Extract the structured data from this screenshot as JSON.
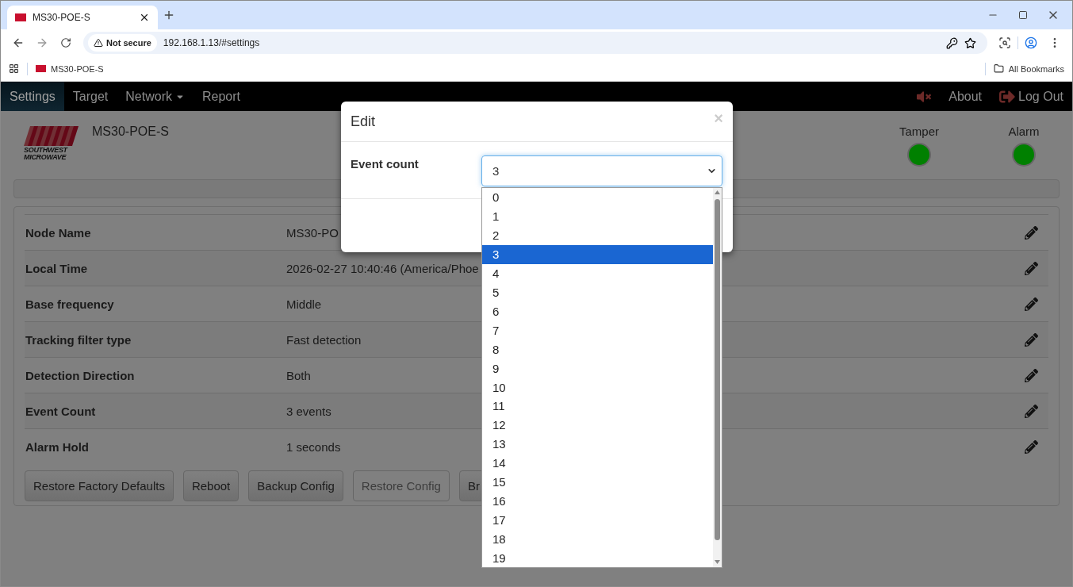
{
  "browser": {
    "tab_title": "MS30-POE-S",
    "security": "Not secure",
    "url": "192.168.1.13/#settings",
    "bookmarks": [
      {
        "label": "MS30-POE-S"
      }
    ],
    "all_bookmarks": "All Bookmarks"
  },
  "nav": {
    "items": [
      {
        "label": "Settings",
        "selected": true,
        "kind": "link"
      },
      {
        "label": "Target",
        "selected": false,
        "kind": "link"
      },
      {
        "label": "Network",
        "selected": false,
        "kind": "dropdown"
      },
      {
        "label": "Report",
        "selected": false,
        "kind": "link"
      }
    ],
    "about": "About",
    "logout": "Log Out"
  },
  "header": {
    "logo_lines": [
      "SOUTHWEST",
      "MICROWAVE"
    ],
    "device_name": "MS30-POE-S",
    "indicators": [
      {
        "label": "Tamper",
        "color": "#008000"
      },
      {
        "label": "Alarm",
        "color": "#008000"
      }
    ]
  },
  "settings": [
    {
      "label": "Node Name",
      "value": "MS30-PO"
    },
    {
      "label": "Local Time",
      "value": "2026-02-27 10:40:46 (America/Phoe"
    },
    {
      "label": "Base frequency",
      "value": "Middle"
    },
    {
      "label": "Tracking filter type",
      "value": "Fast detection"
    },
    {
      "label": "Detection Direction",
      "value": "Both"
    },
    {
      "label": "Event Count",
      "value": "3 events"
    },
    {
      "label": "Alarm Hold",
      "value": "1 seconds"
    }
  ],
  "buttons": [
    {
      "label": "Restore Factory Defaults",
      "disabled": false
    },
    {
      "label": "Reboot",
      "disabled": false
    },
    {
      "label": "Backup Config",
      "disabled": false
    },
    {
      "label": "Restore Config",
      "disabled": true
    },
    {
      "label": "Br",
      "disabled": false
    }
  ],
  "modal": {
    "title": "Edit",
    "close": "×",
    "field_label": "Event count",
    "value": "3",
    "options": [
      {
        "label": "0",
        "selected": false
      },
      {
        "label": "1",
        "selected": false
      },
      {
        "label": "2",
        "selected": false
      },
      {
        "label": "3",
        "selected": true
      },
      {
        "label": "4",
        "selected": false
      },
      {
        "label": "5",
        "selected": false
      },
      {
        "label": "6",
        "selected": false
      },
      {
        "label": "7",
        "selected": false
      },
      {
        "label": "8",
        "selected": false
      },
      {
        "label": "9",
        "selected": false
      },
      {
        "label": "10",
        "selected": false
      },
      {
        "label": "11",
        "selected": false
      },
      {
        "label": "12",
        "selected": false
      },
      {
        "label": "13",
        "selected": false
      },
      {
        "label": "14",
        "selected": false
      },
      {
        "label": "15",
        "selected": false
      },
      {
        "label": "16",
        "selected": false
      },
      {
        "label": "17",
        "selected": false
      },
      {
        "label": "18",
        "selected": false
      },
      {
        "label": "19",
        "selected": false
      }
    ]
  }
}
